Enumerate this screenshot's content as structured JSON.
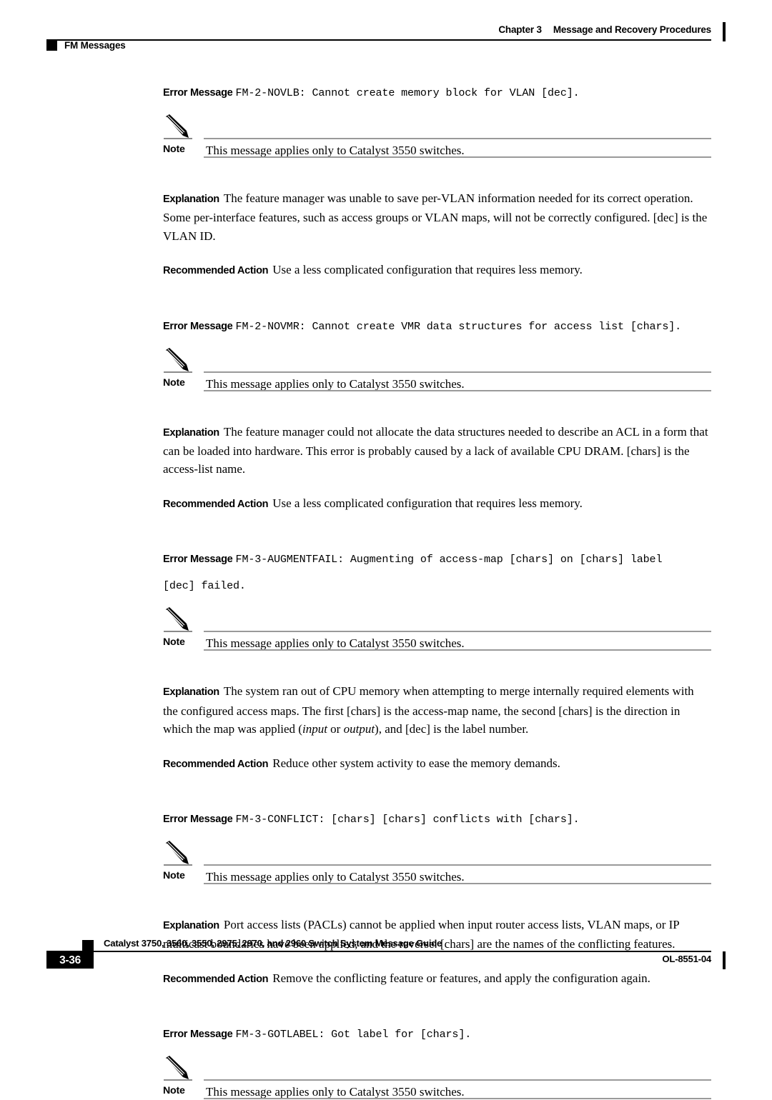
{
  "header": {
    "chapter_num": "Chapter 3",
    "chapter_title": "Message and Recovery Procedures",
    "section_label": "FM Messages"
  },
  "labels": {
    "error_message": "Error Message",
    "note": "Note",
    "explanation": "Explanation",
    "recommended_action": "Recommended Action"
  },
  "blocks": [
    {
      "error_code_line1": "FM-2-NOVLB: Cannot create memory block for VLAN [dec].",
      "error_code_line2": "",
      "note_text": "This message applies only to Catalyst 3550 switches.",
      "explanation": "The feature manager was unable to save per-VLAN information needed for its correct operation. Some per-interface features, such as access groups or VLAN maps, will not be correctly configured. [dec] is the VLAN ID.",
      "recommended_action": "Use a less complicated configuration that requires less memory."
    },
    {
      "error_code_line1": "FM-2-NOVMR: Cannot create VMR data structures for access list [chars].",
      "error_code_line2": "",
      "note_text": "This message applies only to Catalyst 3550 switches.",
      "explanation": "The feature manager could not allocate the data structures needed to describe an ACL in a form that can be loaded into hardware. This error is probably caused by a lack of available CPU DRAM. [chars] is the access-list name.",
      "recommended_action": "Use a less complicated configuration that requires less memory."
    },
    {
      "error_code_line1": "FM-3-AUGMENTFAIL: Augmenting of access-map [chars] on [chars] label",
      "error_code_line2": "[dec] failed.",
      "note_text": "This message applies only to Catalyst 3550 switches.",
      "explanation_pre": "The system ran out of CPU memory when attempting to merge internally required elements with the configured access maps. The first [chars] is the access-map name, the second [chars] is the direction in which the map was applied (",
      "explanation_em1": "input",
      "explanation_mid": " or ",
      "explanation_em2": "output",
      "explanation_post": "), and [dec] is the label number.",
      "recommended_action": "Reduce other system activity to ease the memory demands."
    },
    {
      "error_code_line1": "FM-3-CONFLICT: [chars] [chars] conflicts with [chars].",
      "error_code_line2": "",
      "note_text": "This message applies only to Catalyst 3550 switches.",
      "explanation": "Port access lists (PACLs) cannot be applied when input router access lists, VLAN maps, or IP multicast boundaries have been applied, and the reverse. [chars] are the names of the conflicting features.",
      "recommended_action": "Remove the conflicting feature or features, and apply the configuration again."
    },
    {
      "error_code_line1": "FM-3-GOTLABEL: Got label for [chars].",
      "error_code_line2": "",
      "note_text": "This message applies only to Catalyst 3550 switches.",
      "explanation": "",
      "recommended_action": ""
    }
  ],
  "footer": {
    "guide_title": "Catalyst 3750, 3560, 3550, 2975, 2970, and 2960 Switch System Message Guide",
    "page_number": "3-36",
    "doc_id": "OL-8551-04"
  }
}
